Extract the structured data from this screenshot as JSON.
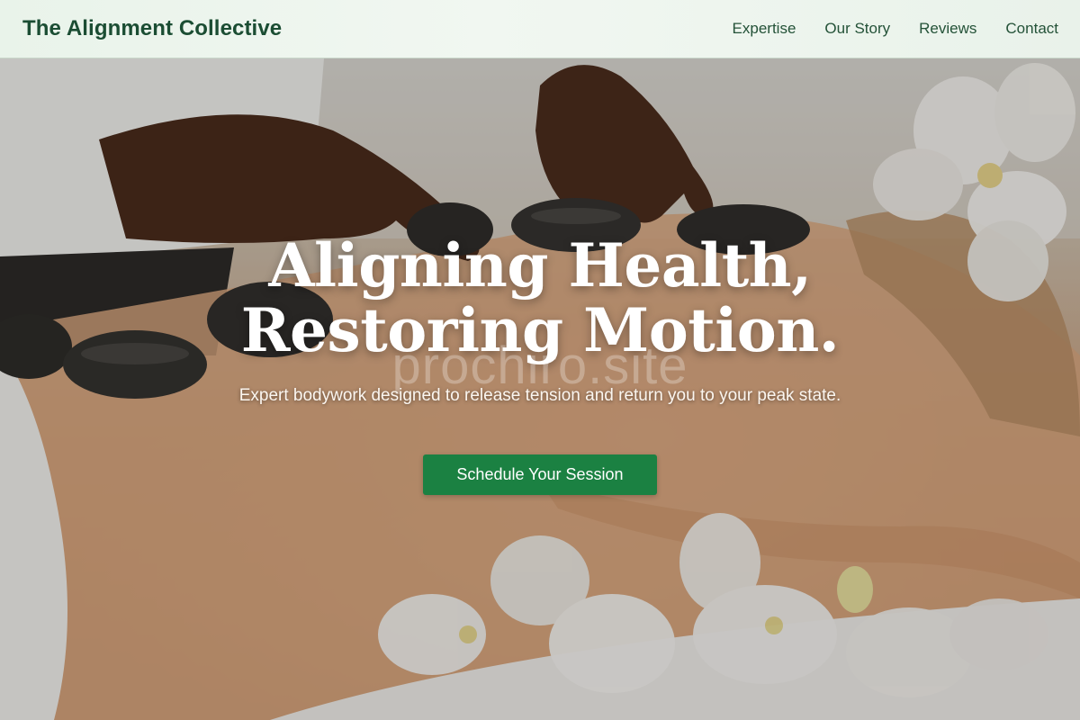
{
  "header": {
    "brand": "The Alignment Collective",
    "nav": [
      {
        "label": "Expertise"
      },
      {
        "label": "Our Story"
      },
      {
        "label": "Reviews"
      },
      {
        "label": "Contact"
      }
    ]
  },
  "hero": {
    "title_line1": "Aligning Health,",
    "title_line2": "Restoring Motion.",
    "watermark": "prochiro.site",
    "subtitle": "Expert bodywork designed to release tension and return you to your peak state.",
    "cta_label": "Schedule Your Session"
  },
  "colors": {
    "brand_green": "#1b4d33",
    "cta_green": "#1b8142",
    "header_bg": "#eef6ef"
  }
}
